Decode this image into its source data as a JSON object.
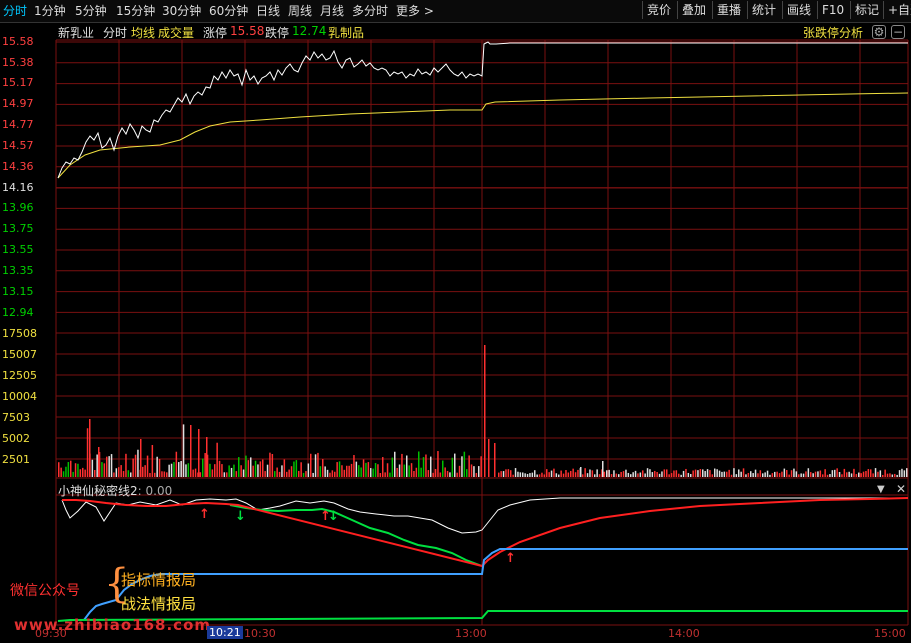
{
  "tabs": [
    "分时",
    "1分钟",
    "5分钟",
    "15分钟",
    "30分钟",
    "60分钟",
    "日线",
    "周线",
    "月线",
    "多分时",
    "更多 >"
  ],
  "right_buttons": [
    "竞价",
    "叠加",
    "重播",
    "统计",
    "画线",
    "F10",
    "标记",
    "+自选"
  ],
  "info": {
    "stock_name": "新乳业",
    "mode": "分时",
    "avg_label": "均线",
    "vol_label": "成交量",
    "limit_up_label": "涨停",
    "limit_up_value": "15.58",
    "limit_down_label": "跌停",
    "limit_down_value": "12.74",
    "sector": "乳制品",
    "analysis_link": "张跌停分析"
  },
  "price_axis": [
    "15.58",
    "15.38",
    "15.17",
    "14.97",
    "14.77",
    "14.57",
    "14.36",
    "14.16",
    "13.96",
    "13.75",
    "13.55",
    "13.35",
    "13.15",
    "12.94"
  ],
  "volume_axis": [
    "17508",
    "15007",
    "12505",
    "10004",
    "7503",
    "5002",
    "2501"
  ],
  "indicator": {
    "title": "小神仙秘密线2",
    "value": ": 0.00"
  },
  "time_axis": {
    "start": "09:30",
    "cursor": "10:21",
    "t1": "10:30",
    "t2": "13:00",
    "t3": "14:00",
    "t4": "15:00"
  },
  "watermark": {
    "left_label": "微信公众号",
    "line1": "指标情报局",
    "line2": "战法情报局",
    "url": "www.zhibiao168.com"
  },
  "colors": {
    "price_up": "#ff4040",
    "price_down": "#00d000",
    "price_line": "#ffffff",
    "avg_line": "#f0e040",
    "grid": "#7a1010",
    "accent": "#00c8ff"
  },
  "chart_data": {
    "type": "line",
    "title": "",
    "x": [
      "09:30",
      "10:30",
      "13:00",
      "14:00",
      "15:00"
    ],
    "series": [
      {
        "name": "price",
        "values": [
          14.36,
          14.57,
          15.25,
          15.5,
          15.58,
          15.58
        ]
      },
      {
        "name": "均线",
        "values": [
          14.36,
          14.55,
          14.8,
          14.9,
          15.0,
          15.04
        ]
      }
    ],
    "ylim": [
      12.74,
      15.58
    ],
    "volume_peak": 15007
  }
}
